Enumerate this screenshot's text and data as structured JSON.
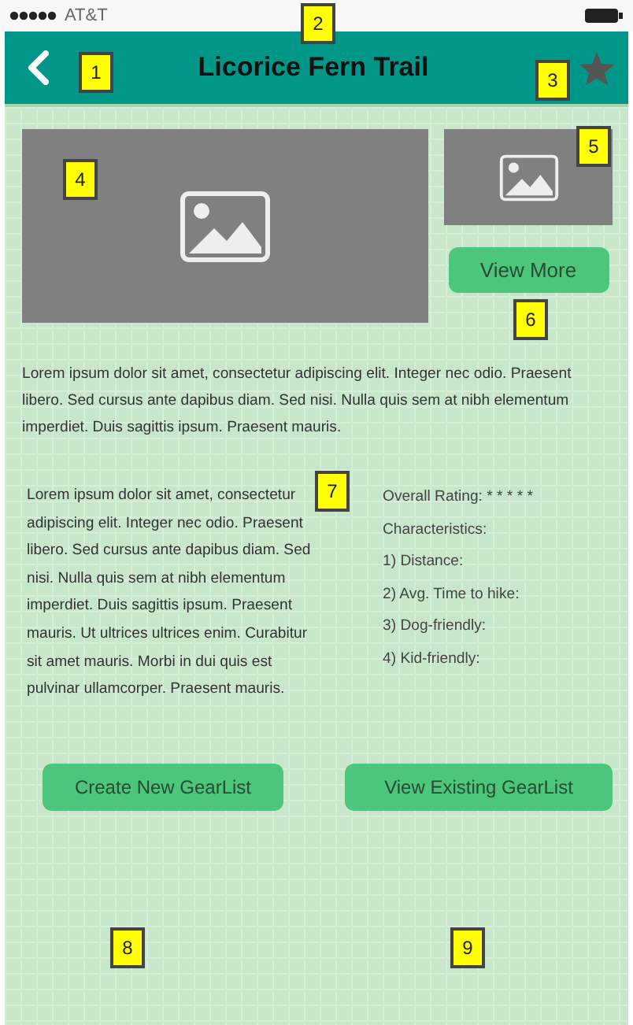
{
  "status_bar": {
    "carrier": "AT&T"
  },
  "header": {
    "title": "Licorice Fern Trail",
    "favorite": false
  },
  "gallery": {
    "view_more": "View More"
  },
  "intro": "Lorem ipsum dolor sit amet, consectetur adipiscing elit. Integer nec odio. Praesent libero. Sed cursus ante dapibus diam. Sed nisi. Nulla quis sem at nibh elementum imperdiet. Duis sagittis ipsum. Praesent mauris.",
  "description": "Lorem ipsum dolor sit amet, consectetur adipiscing elit. Integer nec odio. Praesent libero. Sed cursus ante dapibus diam. Sed nisi. Nulla quis sem at nibh elementum imperdiet. Duis sagittis ipsum. Praesent mauris. Ut ultrices ultrices enim. Curabitur sit amet mauris. Morbi in dui quis est pulvinar ullamcorper. Praesent mauris.",
  "details": [
    "Overall Rating: * * * * *",
    "Characteristics:",
    "1) Distance:",
    "2) Avg. Time to hike:",
    "3) Dog-friendly:",
    "4) Kid-friendly:"
  ],
  "actions": [
    "Create New GearList",
    "View Existing GearList"
  ],
  "callouts": [
    {
      "label": "1"
    },
    {
      "label": "2"
    },
    {
      "label": "3"
    },
    {
      "label": "4"
    },
    {
      "label": "5"
    },
    {
      "label": "6"
    },
    {
      "label": "7"
    },
    {
      "label": "8"
    },
    {
      "label": "9"
    }
  ]
}
